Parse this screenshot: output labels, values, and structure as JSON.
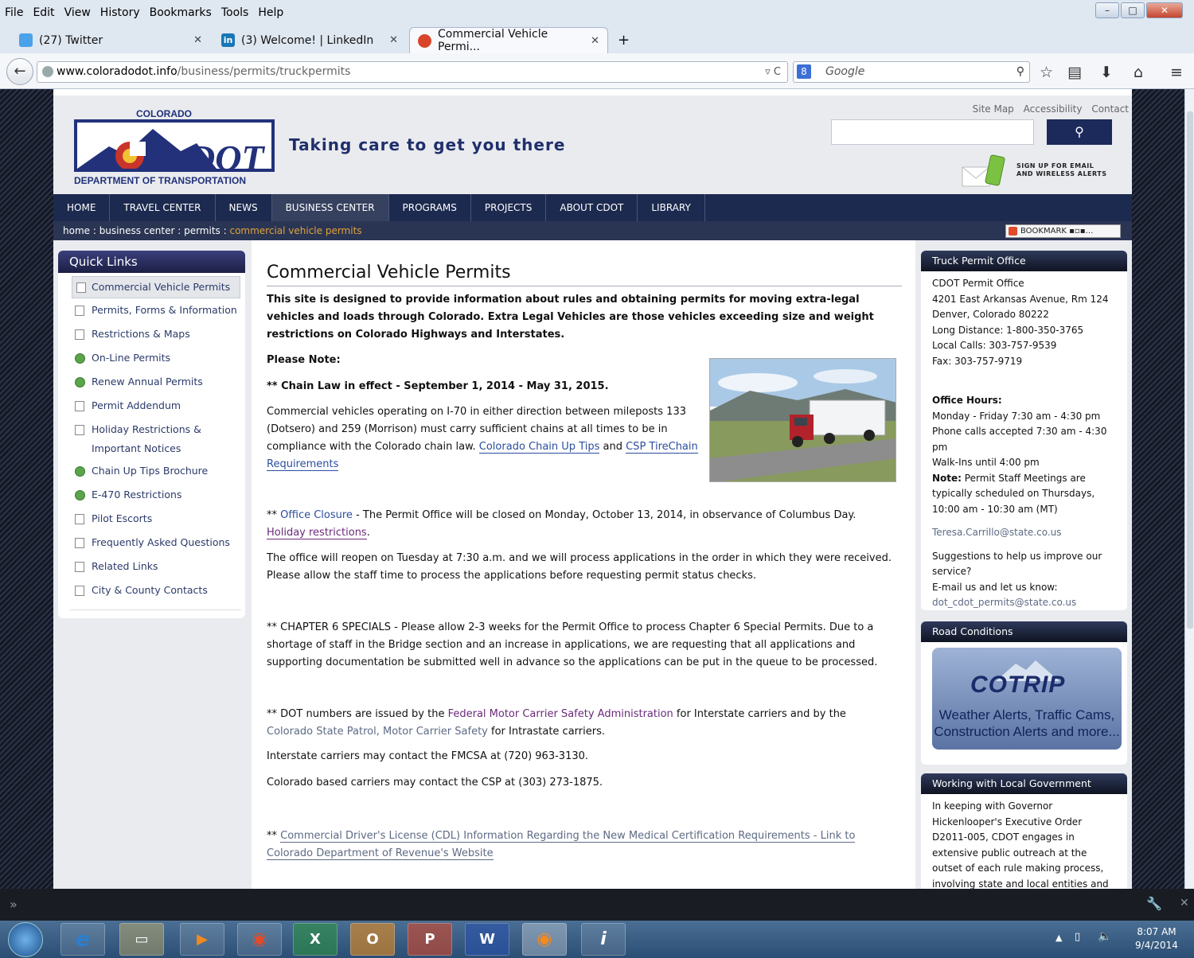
{
  "browser": {
    "menu": [
      "File",
      "Edit",
      "View",
      "History",
      "Bookmarks",
      "Tools",
      "Help"
    ],
    "tabs": [
      {
        "label": "(27) Twitter",
        "color": "#4aa2e8"
      },
      {
        "label": "(3) Welcome! | LinkedIn",
        "color": "#1877b5"
      },
      {
        "label": "Commercial Vehicle Permi...",
        "color": "#d8452b"
      }
    ],
    "url_domain": "www.coloradodot.info",
    "url_path": "/business/permits/truckpermits",
    "search_engine": "8",
    "search_placeholder": "Google"
  },
  "header": {
    "logo_top": "COLORADO",
    "logo_main": "DOT",
    "logo_bottom": "DEPARTMENT OF TRANSPORTATION",
    "tagline": "Taking care to get you there",
    "toplinks": [
      "Site Map",
      "Accessibility",
      "Contact"
    ],
    "alerts_line1": "SIGN UP FOR EMAIL",
    "alerts_line2": "AND WIRELESS ALERTS"
  },
  "nav": [
    "HOME",
    "TRAVEL CENTER",
    "NEWS",
    "BUSINESS CENTER",
    "PROGRAMS",
    "PROJECTS",
    "ABOUT CDOT",
    "LIBRARY"
  ],
  "breadcrumb": {
    "path": "home : business center : permits : ",
    "current": "commercial vehicle permits",
    "bookmark": "BOOKMARK"
  },
  "quicklinks": {
    "title": "Quick Links",
    "items": [
      "Commercial Vehicle Permits",
      "Permits, Forms & Information",
      "Restrictions & Maps",
      "On-Line Permits",
      "Renew Annual Permits",
      "Permit Addendum",
      "Holiday Restrictions &",
      "Important Notices",
      "Chain Up Tips Brochure",
      "E-470 Restrictions",
      "Pilot Escorts",
      "Frequently Asked Questions",
      "Related Links",
      "City & County Contacts"
    ]
  },
  "main": {
    "title": "Commercial Vehicle Permits",
    "intro": "This site is designed to provide information about rules and obtaining permits for moving extra-legal vehicles and loads through Colorado. Extra Legal Vehicles are those vehicles exceeding size and weight restrictions on Colorado Highways and Interstates.",
    "please_note": "Please Note:",
    "chain_law": "** Chain Law in effect - September 1, 2014 - May 31, 2015.",
    "chain_text": "Commercial vehicles operating on I-70 in either direction between mileposts 133 (Dotsero) and 259 (Morrison) must carry sufficient chains at all times to be in compliance with the Colorado chain law. ",
    "chain_link1": "Colorado Chain Up Tips",
    "chain_and": " and ",
    "chain_link2": "CSP TireChain Requirements",
    "closure_prefix": "** ",
    "closure_link": "Office Closure",
    "closure_text": " - The Permit Office will be closed on Monday, October 13, 2014, in observance of Columbus Day. ",
    "holiday_link": "Holiday restrictions",
    "reopen": "The office will reopen on Tuesday at 7:30 a.m. and we will process applications in the order in which they were received.  Please allow the staff time to process the applications before requesting permit status checks.",
    "chapter6": "** CHAPTER 6 SPECIALS - Please allow 2-3 weeks for the Permit Office to process Chapter 6 Special Permits.  Due to a shortage of staff in the Bridge section and an increase in applications, we are requesting that all applications and supporting documentation be submitted well in advance so the applications can be put in the queue to be processed.",
    "dot_prefix": "** DOT numbers are issued by the ",
    "dot_link1": "Federal Motor Carrier Safety Administration",
    "dot_mid": " for Interstate carriers and by the ",
    "dot_link2": "Colorado State Patrol, Motor Carrier Safety",
    "dot_suffix": " for Intrastate carriers.",
    "fmcsa": "Interstate carriers may contact the FMCSA at (720) 963-3130.",
    "csp": "Colorado based carriers may contact the CSP at (303) 273-1875.",
    "cdl_prefix": "** ",
    "cdl_link": "Commercial Driver's License (CDL) Information Regarding the New Medical Certification Requirements - Link to Colorado Department of Revenue's Website"
  },
  "right": {
    "office_title": "Truck Permit Office",
    "office_lines": [
      "CDOT Permit Office",
      "4201 East Arkansas Avenue, Rm 124",
      "Denver, Colorado 80222",
      "Long Distance: 1-800-350-3765",
      "Local Calls: 303-757-9539",
      "Fax:  303-757-9719"
    ],
    "hours_title": "Office Hours:",
    "hours_lines": [
      "Monday - Friday 7:30 am - 4:30 pm",
      "Phone calls accepted 7:30 am - 4:30 pm",
      "Walk-Ins until 4:00 pm"
    ],
    "note_label": "Note:",
    "note_text": " Permit Staff Meetings are typically scheduled on Thursdays, 10:00 am - 10:30 am (MT)",
    "email1": "Teresa.Carrillo@state.co.us",
    "suggest": "Suggestions to help us improve our service?",
    "emailus": "E-mail us and let us know:",
    "email2": "dot_cdot_permits@state.co.us",
    "road_title": "Road Conditions",
    "cotrip": "COTRIP",
    "cotrip_sub1": "Weather Alerts, Traffic Cams,",
    "cotrip_sub2": "Construction Alerts and more...",
    "local_title": "Working with Local Government",
    "local_text": "In keeping with Governor Hickenlooper's Executive Order D2011-005, CDOT engages in extensive public outreach at the outset of each rule making process, involving state and local entities and individuals in the development of the"
  },
  "taskbar": {
    "time": "8:07 AM",
    "date": "9/4/2014"
  }
}
